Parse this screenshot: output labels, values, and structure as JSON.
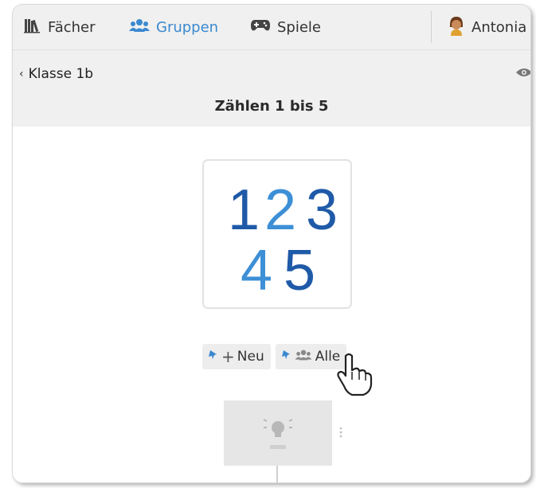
{
  "nav": {
    "items": [
      {
        "label": "Fächer",
        "icon": "books-icon"
      },
      {
        "label": "Gruppen",
        "icon": "group-icon",
        "active": true
      },
      {
        "label": "Spiele",
        "icon": "gamepad-icon"
      }
    ],
    "user": {
      "name": "Antonia",
      "icon": "avatar"
    }
  },
  "header": {
    "back_label": "Klasse 1b",
    "title": "Zählen 1 bis 5"
  },
  "card": {
    "numbers_row1": [
      "1",
      "2",
      "3"
    ],
    "numbers_row2": [
      "4",
      "5"
    ]
  },
  "actions": {
    "new_label": "Neu",
    "all_label": "Alle"
  },
  "colors": {
    "accent": "#3b89d0",
    "numeral_dark": "#1f5aa8",
    "numeral_light": "#3d8fd6"
  }
}
